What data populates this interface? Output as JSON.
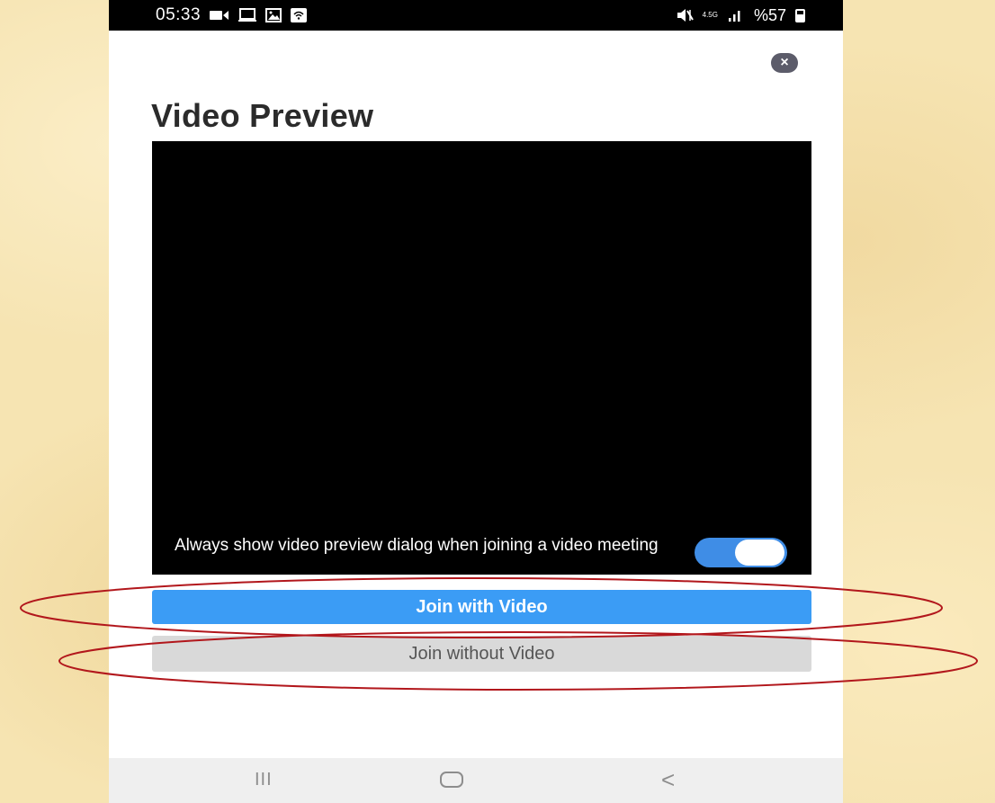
{
  "status_bar": {
    "time": "05:33",
    "left_icons": [
      "video-call-icon",
      "cast-icon",
      "gallery-icon",
      "wifi-icon"
    ],
    "network_label": "4.5G",
    "battery_text": "%57",
    "right_icons": [
      "mute-icon",
      "network-type-icon",
      "signal-icon",
      "battery-icon"
    ]
  },
  "dialog": {
    "close_icon": "close-icon",
    "close_glyph": "×",
    "title": "Video Preview",
    "preview_option_text": "Always show video preview dialog when joining a video meeting",
    "preview_toggle_on": true,
    "join_with_video_label": "Join with Video",
    "join_without_video_label": "Join without Video"
  },
  "nav_bar": {
    "recents_glyph": "III",
    "back_glyph": "<",
    "icons": [
      "recents-icon",
      "home-icon",
      "back-icon"
    ]
  },
  "colors": {
    "primary_button": "#3b9cf5",
    "secondary_button": "#d9d9d9",
    "toggle_on": "#3f8de6",
    "annotation_ellipse": "#b2171c",
    "background": "#f6e4b2"
  }
}
